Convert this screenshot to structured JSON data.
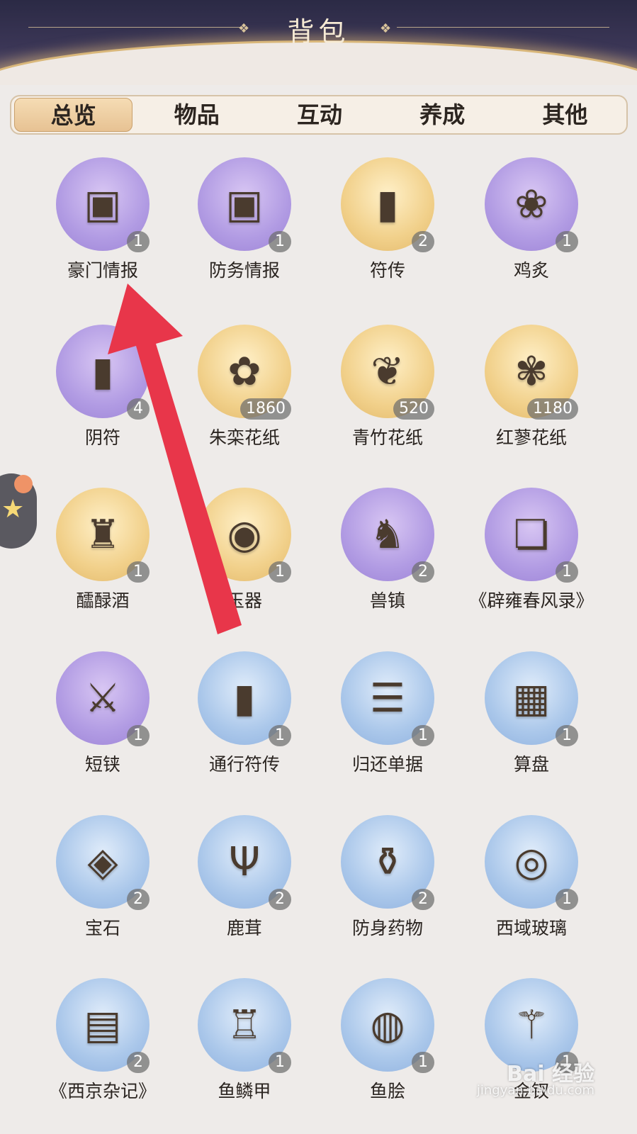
{
  "header": {
    "title": "背包"
  },
  "tabs": [
    {
      "label": "总览",
      "active": true
    },
    {
      "label": "物品",
      "active": false
    },
    {
      "label": "互动",
      "active": false
    },
    {
      "label": "养成",
      "active": false
    },
    {
      "label": "其他",
      "active": false
    }
  ],
  "items": [
    {
      "name": "豪门情报",
      "count": "1",
      "bg": "purple",
      "icon": "jade-tablet-icon",
      "glyph": "▣"
    },
    {
      "name": "防务情报",
      "count": "1",
      "bg": "purple",
      "icon": "jade-tablet-icon",
      "glyph": "▣"
    },
    {
      "name": "符传",
      "count": "2",
      "bg": "gold",
      "icon": "tally-icon",
      "glyph": "▮"
    },
    {
      "name": "鸡炙",
      "count": "1",
      "bg": "purple",
      "icon": "pouch-icon",
      "glyph": "❀"
    },
    {
      "name": "阴符",
      "count": "4",
      "bg": "purple",
      "icon": "tally-icon",
      "glyph": "▮"
    },
    {
      "name": "朱栾花纸",
      "count": "1860",
      "bg": "gold",
      "icon": "flower-paper-icon",
      "glyph": "✿"
    },
    {
      "name": "青竹花纸",
      "count": "520",
      "bg": "gold",
      "icon": "bamboo-scroll-icon",
      "glyph": "❦"
    },
    {
      "name": "红蓼花纸",
      "count": "1180",
      "bg": "gold",
      "icon": "flower-dish-icon",
      "glyph": "✾"
    },
    {
      "name": "醽醁酒",
      "count": "1",
      "bg": "gold",
      "icon": "wine-cup-icon",
      "glyph": "♜"
    },
    {
      "name": "玉器",
      "count": "1",
      "bg": "gold",
      "icon": "jade-disc-icon",
      "glyph": "◉"
    },
    {
      "name": "兽镇",
      "count": "2",
      "bg": "purple",
      "icon": "deer-statue-icon",
      "glyph": "♞"
    },
    {
      "name": "《辟雍春风录》",
      "count": "1",
      "bg": "purple",
      "icon": "scroll-icon",
      "glyph": "❏"
    },
    {
      "name": "短铗",
      "count": "1",
      "bg": "purple",
      "icon": "dagger-icon",
      "glyph": "⚔"
    },
    {
      "name": "通行符传",
      "count": "1",
      "bg": "blue",
      "icon": "pass-token-icon",
      "glyph": "▮"
    },
    {
      "name": "归还单据",
      "count": "1",
      "bg": "blue",
      "icon": "bamboo-slips-icon",
      "glyph": "☰"
    },
    {
      "name": "算盘",
      "count": "1",
      "bg": "blue",
      "icon": "abacus-icon",
      "glyph": "▦"
    },
    {
      "name": "宝石",
      "count": "2",
      "bg": "blue",
      "icon": "jewel-box-icon",
      "glyph": "◈"
    },
    {
      "name": "鹿茸",
      "count": "2",
      "bg": "blue",
      "icon": "antler-icon",
      "glyph": "Ψ"
    },
    {
      "name": "防身药物",
      "count": "2",
      "bg": "blue",
      "icon": "potion-bottle-icon",
      "glyph": "⚱"
    },
    {
      "name": "西域玻璃",
      "count": "1",
      "bg": "blue",
      "icon": "glass-ring-icon",
      "glyph": "◎"
    },
    {
      "name": "《西京杂记》",
      "count": "2",
      "bg": "blue",
      "icon": "book-box-icon",
      "glyph": "▤"
    },
    {
      "name": "鱼鳞甲",
      "count": "1",
      "bg": "blue",
      "icon": "armor-icon",
      "glyph": "♖"
    },
    {
      "name": "鱼脍",
      "count": "1",
      "bg": "blue",
      "icon": "fish-plate-icon",
      "glyph": "◍"
    },
    {
      "name": "金钗",
      "count": "1",
      "bg": "blue",
      "icon": "hairpin-icon",
      "glyph": "⚚"
    }
  ],
  "watermark": {
    "brand": "Bai 经验",
    "url": "jingyan.baidu.com"
  },
  "colors": {
    "arrow": "#e8364a",
    "header_dark": "#2b2a45",
    "tab_active": "#e7c293"
  }
}
